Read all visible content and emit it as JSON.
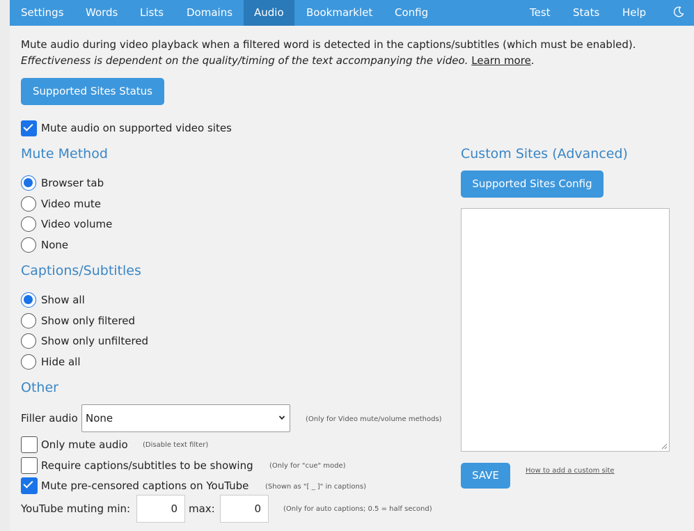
{
  "nav": {
    "tabs": [
      {
        "label": "Settings"
      },
      {
        "label": "Words"
      },
      {
        "label": "Lists"
      },
      {
        "label": "Domains"
      },
      {
        "label": "Audio",
        "active": true
      },
      {
        "label": "Bookmarklet"
      },
      {
        "label": "Config"
      },
      {
        "label": "Test"
      },
      {
        "label": "Stats"
      },
      {
        "label": "Help"
      }
    ],
    "theme_icon": "moon-icon"
  },
  "description": {
    "line1": "Mute audio during video playback when a filtered word is detected in the captions/subtitles (which must be enabled).",
    "line2": "Effectiveness is dependent on the quality/timing of the text accompanying the video.",
    "learn_more": "Learn more",
    "period": "."
  },
  "buttons": {
    "supported_sites_status": "Supported Sites Status",
    "supported_sites_config": "Supported Sites Config",
    "save": "SAVE"
  },
  "mute_audio": {
    "label": "Mute audio on supported video sites",
    "checked": true
  },
  "mute_method": {
    "heading": "Mute Method",
    "options": [
      {
        "label": "Browser tab",
        "checked": true
      },
      {
        "label": "Video mute",
        "checked": false
      },
      {
        "label": "Video volume",
        "checked": false
      },
      {
        "label": "None",
        "checked": false
      }
    ]
  },
  "captions": {
    "heading": "Captions/Subtitles",
    "options": [
      {
        "label": "Show all",
        "checked": true
      },
      {
        "label": "Show only filtered",
        "checked": false
      },
      {
        "label": "Show only unfiltered",
        "checked": false
      },
      {
        "label": "Hide all",
        "checked": false
      }
    ]
  },
  "other": {
    "heading": "Other",
    "filler_audio": {
      "label": "Filler audio",
      "value": "None",
      "note": "(Only for Video mute/volume methods)"
    },
    "only_mute_audio": {
      "label": "Only mute audio",
      "note": "(Disable text filter)",
      "checked": false
    },
    "require_captions": {
      "label": "Require captions/subtitles to be showing",
      "note": "(Only for \"cue\" mode)",
      "checked": false
    },
    "mute_precensored": {
      "label": "Mute pre-censored captions on YouTube",
      "note": "(Shown as \"[ _ ]\" in captions)",
      "checked": true
    },
    "youtube_min": {
      "label": "YouTube muting min:",
      "value": "0"
    },
    "youtube_max": {
      "label": "max:",
      "value": "0"
    },
    "youtube_note": "(Only for auto captions; 0.5 = half second)"
  },
  "custom_sites": {
    "heading": "Custom Sites (Advanced)",
    "help_link": "How to add a custom site"
  },
  "colors": {
    "accent": "#3d97dc",
    "active_tab": "#2a79b8",
    "heading": "#3a86c5",
    "check": "#1a73e8"
  }
}
